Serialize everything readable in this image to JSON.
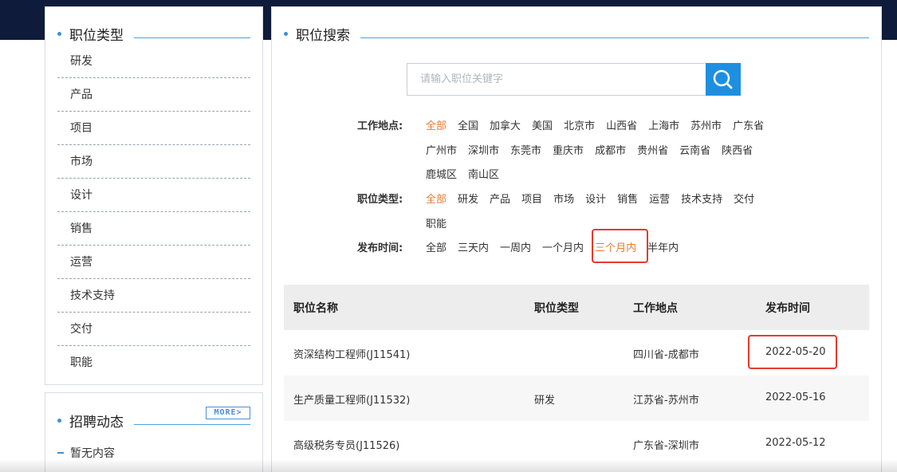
{
  "sidebar": {
    "title": "职位类型",
    "categories": [
      "研发",
      "产品",
      "项目",
      "市场",
      "设计",
      "销售",
      "运营",
      "技术支持",
      "交付",
      "职能"
    ]
  },
  "news": {
    "title": "招聘动态",
    "more": "MORE>",
    "empty_text": "暂无内容"
  },
  "search": {
    "title": "职位搜索",
    "placeholder": "请输入职位关键字"
  },
  "filters": {
    "location": {
      "label": "工作地点:",
      "row1": [
        "全部",
        "全国",
        "加拿大",
        "美国",
        "北京市",
        "山西省",
        "上海市",
        "苏州市",
        "广东省"
      ],
      "row2": [
        "广州市",
        "深圳市",
        "东莞市",
        "重庆市",
        "成都市",
        "贵州省",
        "云南省",
        "陕西省"
      ],
      "row3": [
        "鹿城区",
        "南山区"
      ]
    },
    "type": {
      "label": "职位类型:",
      "row1": [
        "全部",
        "研发",
        "产品",
        "项目",
        "市场",
        "设计",
        "销售",
        "运营",
        "技术支持",
        "交付"
      ],
      "row2": [
        "职能"
      ]
    },
    "time": {
      "label": "发布时间:",
      "options": [
        "全部",
        "三天内",
        "一周内",
        "一个月内",
        "三个月内",
        "半年内"
      ]
    }
  },
  "table": {
    "headers": [
      "职位名称",
      "职位类型",
      "工作地点",
      "发布时间"
    ],
    "rows": [
      {
        "name": "资深结构工程师(J11541)",
        "type": "",
        "location": "四川省-成都市",
        "date": "2022-05-20"
      },
      {
        "name": "生产质量工程师(J11532)",
        "type": "研发",
        "location": "江苏省-苏州市",
        "date": "2022-05-16"
      },
      {
        "name": "高级税务专员(J11526)",
        "type": "",
        "location": "广东省-深圳市",
        "date": "2022-05-12"
      }
    ]
  },
  "colors": {
    "accent_orange": "#e47b32",
    "highlight_red": "#e23b2f",
    "search_blue": "#1e8fe0",
    "top_band": "#0f1b3b"
  }
}
